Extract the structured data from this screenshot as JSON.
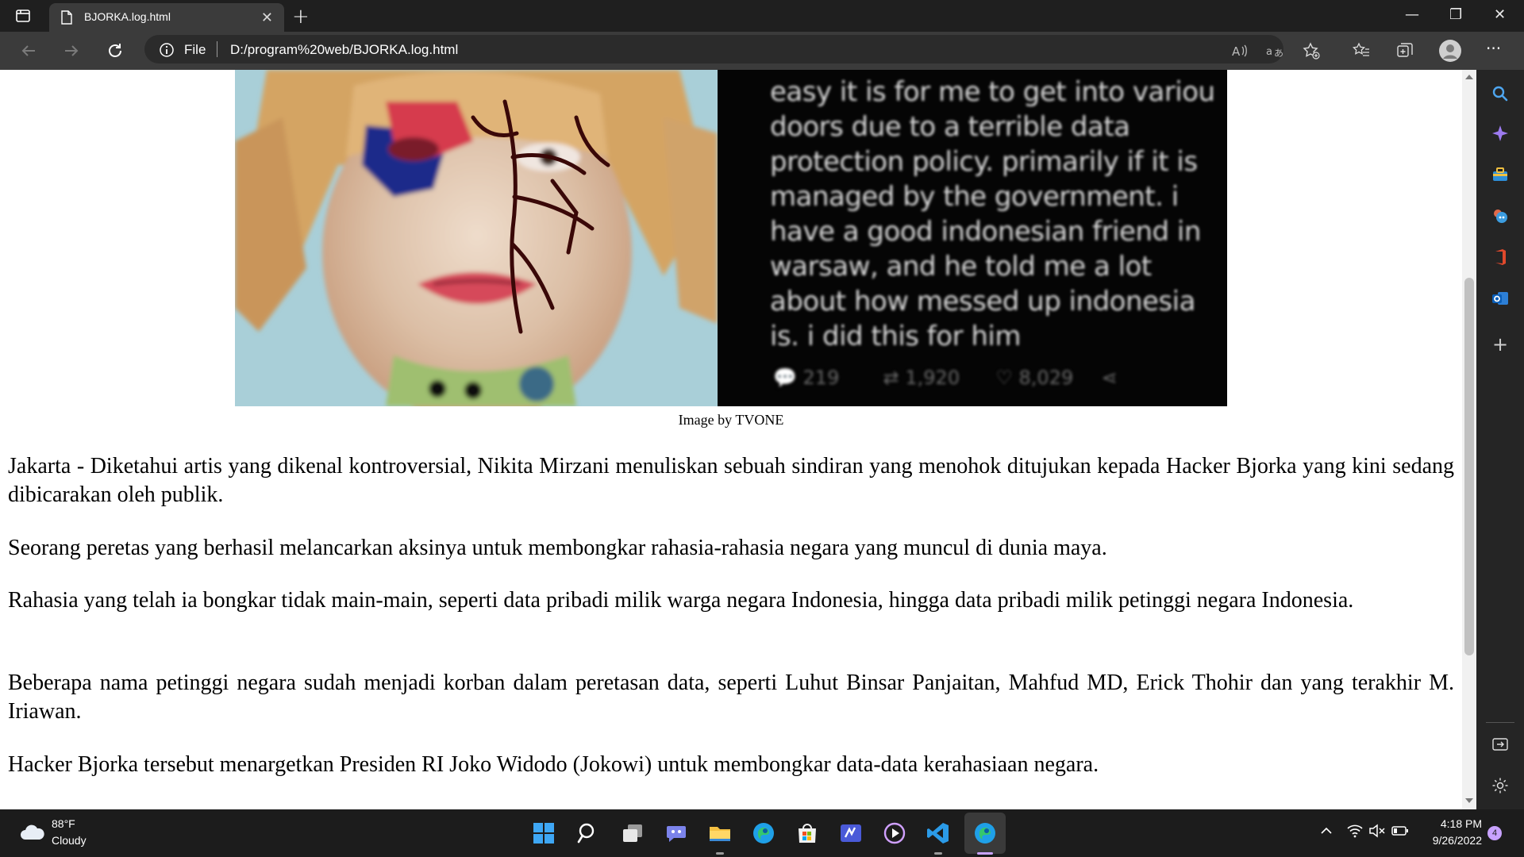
{
  "browser": {
    "tab_title": "BJORKA.log.html",
    "address_scheme": "File",
    "address_url": "D:/program%20web/BJORKA.log.html"
  },
  "hero": {
    "tweet_lines": [
      "easy it is for me to get into variou",
      "doors due to a terrible data",
      "protection policy. primarily if it is",
      "managed by the government. i",
      "have a good indonesian friend in",
      "warsaw, and he told me a lot",
      "about how messed up indonesia",
      "is. i did this for him"
    ],
    "tweet_stats": {
      "replies": "219",
      "retweets": "1,920",
      "likes": "8,029"
    },
    "caption": "Image by TVONE"
  },
  "article": {
    "paragraphs": [
      "Jakarta - Diketahui artis yang dikenal kontroversial, Nikita Mirzani menuliskan sebuah sindiran yang menohok ditujukan kepada Hacker Bjorka yang kini sedang dibicarakan oleh publik.",
      "Seorang peretas yang berhasil melancarkan aksinya untuk membongkar rahasia-rahasia negara yang muncul di dunia maya.",
      "Rahasia yang telah ia bongkar tidak main-main, seperti data pribadi milik warga negara Indonesia, hingga data pribadi milik petinggi negara Indonesia.",
      "Beberapa nama petinggi negara sudah menjadi korban dalam peretasan data, seperti Luhut Binsar Panjaitan, Mahfud MD, Erick Thohir dan yang terakhir M. Iriawan.",
      "Hacker Bjorka tersebut menargetkan Presiden RI Joko Widodo (Jokowi) untuk membongkar data-data kerahasiaan negara."
    ]
  },
  "taskbar": {
    "weather_temp": "88°F",
    "weather_condition": "Cloudy",
    "time": "4:18 PM",
    "date": "9/26/2022",
    "notification_count": "4"
  },
  "colors": {
    "accent": "#0078d4",
    "edge_blue": "#1fa0e8",
    "notification_badge": "#c8a2ff"
  }
}
